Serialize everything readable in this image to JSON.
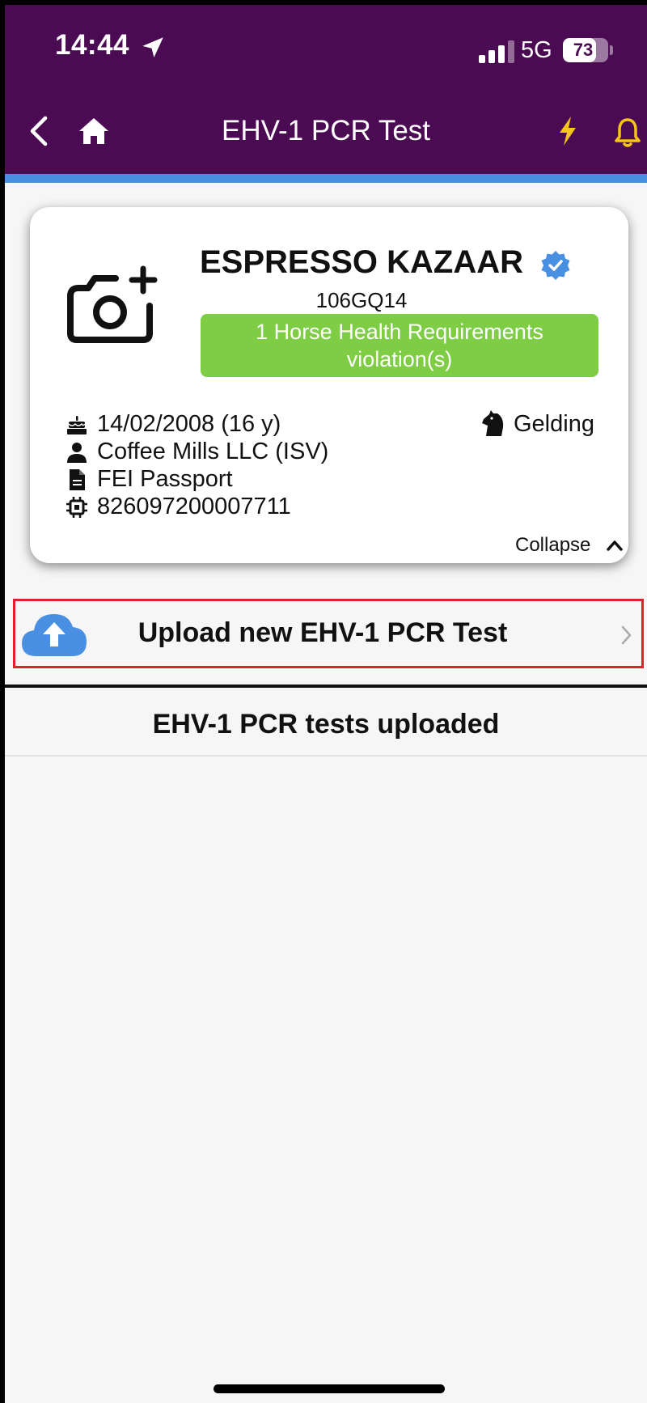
{
  "status_bar": {
    "time": "14:44",
    "network": "5G",
    "battery": "73",
    "battery_level": 0.73
  },
  "header": {
    "title": "EHV-1 PCR Test"
  },
  "horse_card": {
    "name": "ESPRESSO KAZAAR",
    "id": "106GQ14",
    "violation": "1 Horse Health Requirements violation(s)",
    "birth": "14/02/2008 (16 y)",
    "owner": "Coffee Mills LLC (ISV)",
    "passport": "FEI Passport",
    "chip": "826097200007711",
    "gender": "Gelding",
    "collapse_label": "Collapse"
  },
  "upload": {
    "label": "Upload new EHV-1 PCR Test"
  },
  "tests_section": {
    "title": "EHV-1 PCR tests uploaded"
  },
  "colors": {
    "header_bg": "#4a0b52",
    "accent_blue": "#4a90e2",
    "violation_green": "#7ecd45",
    "highlight_red": "#e0202c",
    "warning_yellow": "#f5c518"
  }
}
